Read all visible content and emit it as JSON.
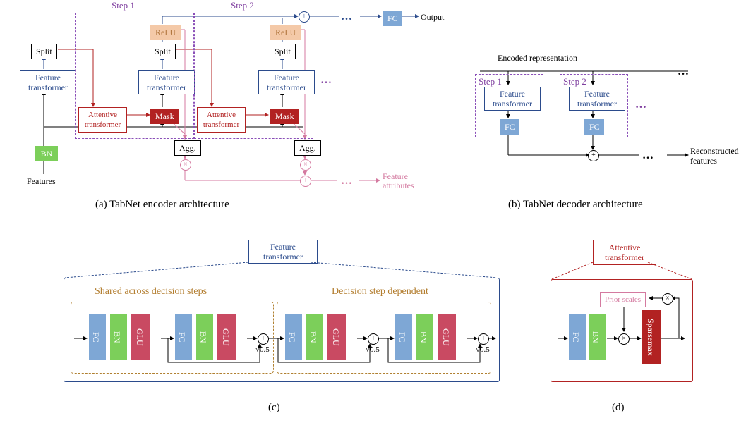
{
  "encoder": {
    "features": "Features",
    "bn": "BN",
    "ft": "Feature\ntransformer",
    "split": "Split",
    "relu": "ReLU",
    "attentive": "Attentive\ntransformer",
    "mask": "Mask",
    "agg": "Agg.",
    "step1": "Step 1",
    "step2": "Step 2",
    "fc": "FC",
    "output": "Output",
    "feat_attr": "Feature\nattributes",
    "caption": "(a) TabNet encoder architecture"
  },
  "decoder": {
    "encoded": "Encoded representation",
    "step1": "Step 1",
    "step2": "Step 2",
    "ft": "Feature\ntransformer",
    "fc": "FC",
    "recon": "Reconstructed\nfeatures",
    "caption": "(b) TabNet decoder architecture"
  },
  "feature_transformer": {
    "title": "Feature\ntransformer",
    "shared": "Shared across decision steps",
    "dependent": "Decision step dependent",
    "fc": "FC",
    "bn": "BN",
    "glu": "GLU",
    "sqrt": "√0.5",
    "caption": "(c)"
  },
  "attentive_transformer": {
    "title": "Attentive\ntransformer",
    "fc": "FC",
    "bn": "BN",
    "prior": "Prior scales",
    "sparsemax": "Sparsemax",
    "caption": "(d)"
  }
}
